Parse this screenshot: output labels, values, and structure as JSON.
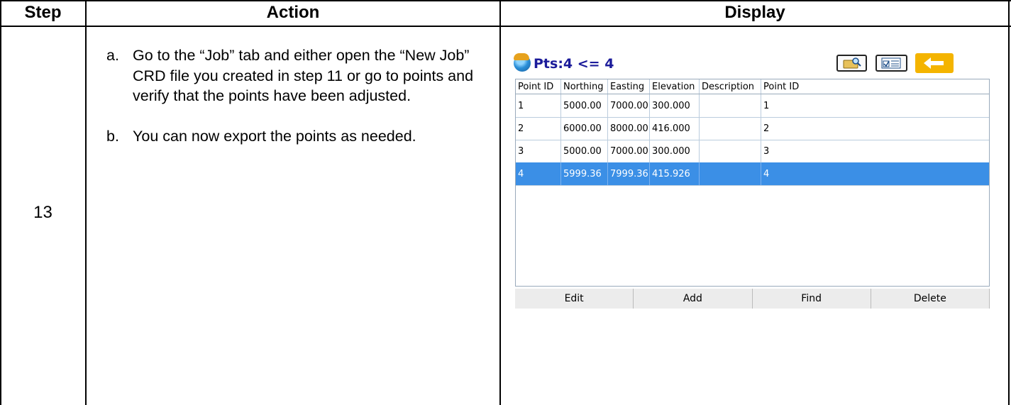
{
  "table": {
    "headers": {
      "step": "Step",
      "action": "Action",
      "display": "Display"
    },
    "row": {
      "step": "13",
      "actions": [
        {
          "label": "a.",
          "text": "Go to the “Job” tab and either open the “New Job” CRD file you created in step 11 or go to points and verify that the points have been adjusted."
        },
        {
          "label": "b.",
          "text": "You can now export the points as needed."
        }
      ]
    }
  },
  "app": {
    "title": "Pts:4 <= 4",
    "toolbar_icons": [
      "search-folder-icon",
      "checklist-icon",
      "back-arrow-icon"
    ],
    "accent_color": "#f4b400",
    "selected_row_color": "#3b8fe6",
    "grid": {
      "columns": [
        "Point ID",
        "Northing",
        "Easting",
        "Elevation",
        "Description",
        "Point ID"
      ],
      "rows": [
        [
          "1",
          "5000.00",
          "7000.00",
          "300.000",
          "",
          "1"
        ],
        [
          "2",
          "6000.00",
          "8000.00",
          "416.000",
          "",
          "2"
        ],
        [
          "3",
          "5000.00",
          "7000.00",
          "300.000",
          "",
          "3"
        ],
        [
          "4",
          "5999.36",
          "7999.36",
          "415.926",
          "",
          "4"
        ]
      ],
      "selected_row": 3
    },
    "softkeys": [
      "Edit",
      "Add",
      "Find",
      "Delete"
    ]
  }
}
